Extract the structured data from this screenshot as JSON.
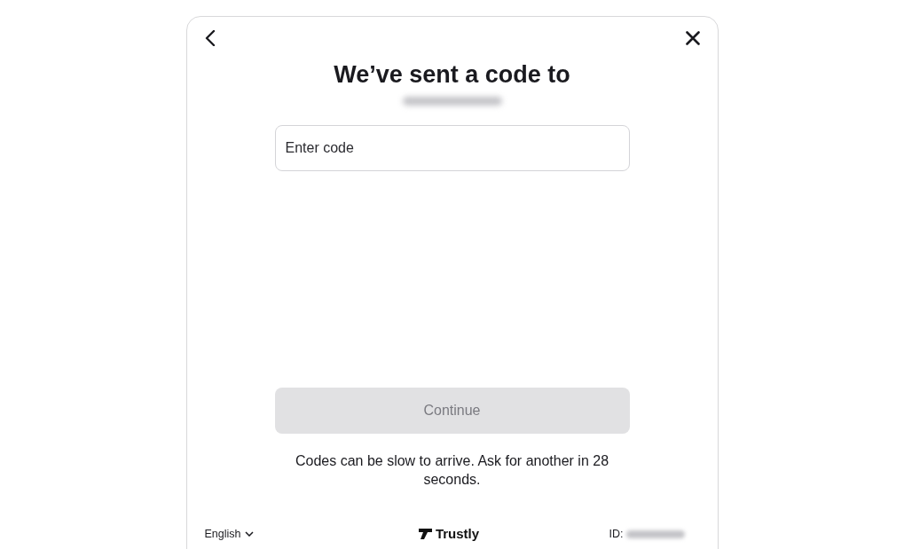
{
  "dialog": {
    "title": "We’ve sent a code to"
  },
  "code_field": {
    "placeholder": "Enter code"
  },
  "continue_button": {
    "label": "Continue",
    "disabled": true
  },
  "notice": "Codes can be slow to arrive. Ask for another in 28 seconds.",
  "footer": {
    "language": "English",
    "brand": "Trustly",
    "id_label": "ID:"
  }
}
